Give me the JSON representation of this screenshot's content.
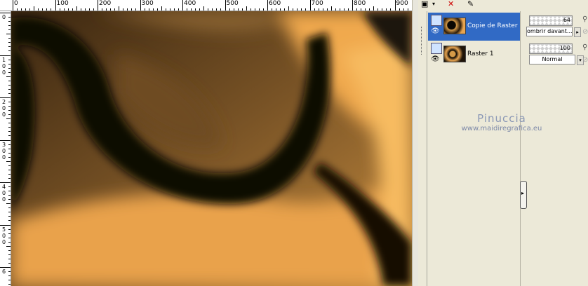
{
  "ruler": {
    "top_labels": [
      "0",
      "100",
      "200",
      "300",
      "400",
      "500",
      "600",
      "700",
      "800",
      "900"
    ],
    "left_labels": [
      [
        "0"
      ],
      [
        "1",
        "0",
        "0"
      ],
      [
        "2",
        "0",
        "0"
      ],
      [
        "3",
        "0",
        "0"
      ],
      [
        "4",
        "0",
        "0"
      ],
      [
        "5",
        "0",
        "0"
      ],
      [
        "6"
      ]
    ]
  },
  "layers": {
    "toolbar": {
      "new_layer": "new-layer-icon",
      "delete": "delete-layer-icon",
      "edit": "edit-layer-icon"
    },
    "items": [
      {
        "name": "Copie de Raster 1",
        "selected": true,
        "opacity": "64",
        "blend": "ombrir davant..."
      },
      {
        "name": "Raster 1",
        "selected": false,
        "opacity": "100",
        "blend": "Normal"
      }
    ]
  },
  "watermark": {
    "title": "Pinuccia",
    "url": "www.maidiregrafica.eu"
  },
  "colors": {
    "selection": "#316ac5",
    "panel": "#ece9d8",
    "gold": "#f4b55a",
    "dark": "#0c0904"
  }
}
